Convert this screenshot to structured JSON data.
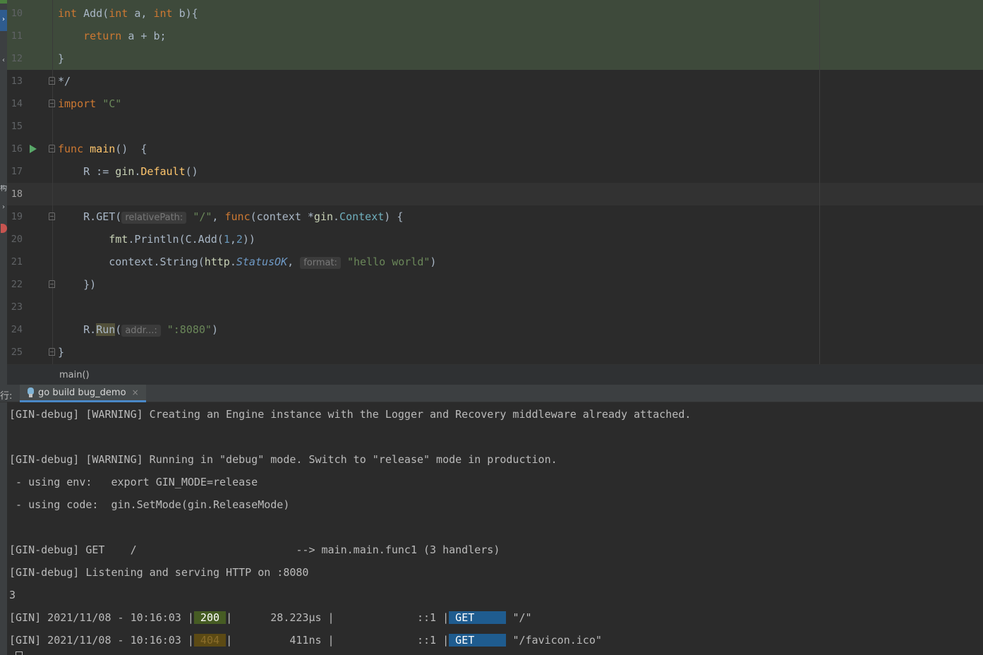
{
  "editor": {
    "lines": [
      {
        "num": "10",
        "segments": [
          {
            "c": "kw",
            "t": "int"
          },
          {
            "c": "",
            "t": " Add("
          },
          {
            "c": "kw",
            "t": "int"
          },
          {
            "c": "",
            "t": " a, "
          },
          {
            "c": "kw",
            "t": "int"
          },
          {
            "c": "",
            "t": " b){"
          }
        ]
      },
      {
        "num": "11",
        "segments": [
          {
            "c": "",
            "t": "    "
          },
          {
            "c": "kw",
            "t": "return"
          },
          {
            "c": "",
            "t": " a + b;"
          }
        ]
      },
      {
        "num": "12",
        "segments": [
          {
            "c": "",
            "t": "}"
          }
        ]
      },
      {
        "num": "13",
        "segments": [
          {
            "c": "",
            "t": "*/"
          }
        ]
      },
      {
        "num": "14",
        "segments": [
          {
            "c": "kw",
            "t": "import"
          },
          {
            "c": "",
            "t": " "
          },
          {
            "c": "str",
            "t": "\"C\""
          }
        ]
      },
      {
        "num": "15",
        "segments": []
      },
      {
        "num": "16",
        "segments": [
          {
            "c": "kw",
            "t": "func"
          },
          {
            "c": "",
            "t": " "
          },
          {
            "c": "fn",
            "t": "main"
          },
          {
            "c": "",
            "t": "()  {"
          }
        ]
      },
      {
        "num": "17",
        "segments": [
          {
            "c": "",
            "t": "    R := "
          },
          {
            "c": "pkg",
            "t": "gin"
          },
          {
            "c": "",
            "t": "."
          },
          {
            "c": "fn",
            "t": "Default"
          },
          {
            "c": "",
            "t": "()"
          }
        ]
      },
      {
        "num": "18",
        "segments": []
      },
      {
        "num": "19",
        "segments": [
          {
            "c": "",
            "t": "    R."
          },
          {
            "c": "",
            "t": "GET"
          },
          {
            "c": "",
            "t": "("
          },
          {
            "c": "hint",
            "t": "relativePath:"
          },
          {
            "c": "",
            "t": " "
          },
          {
            "c": "str",
            "t": "\"/\""
          },
          {
            "c": "",
            "t": ", "
          },
          {
            "c": "kw",
            "t": "func"
          },
          {
            "c": "",
            "t": "(context *"
          },
          {
            "c": "pkg",
            "t": "gin"
          },
          {
            "c": "",
            "t": "."
          },
          {
            "c": "typ",
            "t": "Context"
          },
          {
            "c": "",
            "t": ") {"
          }
        ]
      },
      {
        "num": "20",
        "segments": [
          {
            "c": "",
            "t": "        "
          },
          {
            "c": "pkg",
            "t": "fmt"
          },
          {
            "c": "",
            "t": "."
          },
          {
            "c": "",
            "t": "Println(C.Add("
          },
          {
            "c": "num",
            "t": "1"
          },
          {
            "c": "",
            "t": ","
          },
          {
            "c": "num",
            "t": "2"
          },
          {
            "c": "",
            "t": "))"
          }
        ]
      },
      {
        "num": "21",
        "segments": [
          {
            "c": "",
            "t": "        context."
          },
          {
            "c": "",
            "t": "String"
          },
          {
            "c": "",
            "t": "("
          },
          {
            "c": "pkg",
            "t": "http"
          },
          {
            "c": "",
            "t": "."
          },
          {
            "c": "ital",
            "t": "StatusOK"
          },
          {
            "c": "",
            "t": ", "
          },
          {
            "c": "hint",
            "t": "format:"
          },
          {
            "c": "",
            "t": " "
          },
          {
            "c": "str",
            "t": "\"hello world\""
          },
          {
            "c": "",
            "t": ")"
          }
        ]
      },
      {
        "num": "22",
        "segments": [
          {
            "c": "",
            "t": "    })"
          }
        ]
      },
      {
        "num": "23",
        "segments": []
      },
      {
        "num": "24",
        "segments": [
          {
            "c": "",
            "t": "    R."
          },
          {
            "c": "run-hl",
            "t": "Run"
          },
          {
            "c": "",
            "t": "("
          },
          {
            "c": "hint",
            "t": "addr...:"
          },
          {
            "c": "",
            "t": " "
          },
          {
            "c": "str",
            "t": "\":8080\""
          },
          {
            "c": "",
            "t": ")"
          }
        ]
      },
      {
        "num": "25",
        "segments": [
          {
            "c": "",
            "t": "}"
          }
        ]
      }
    ]
  },
  "breadcrumb": {
    "text": "main()"
  },
  "run_window": {
    "label": "行:",
    "tab_label": "go build bug_demo",
    "tab_close": "×"
  },
  "console": {
    "lines": [
      {
        "segments": [
          {
            "c": "",
            "t": "[GIN-debug] [WARNING] Creating an Engine instance with the Logger and Recovery middleware already attached."
          }
        ]
      },
      {
        "segments": []
      },
      {
        "segments": [
          {
            "c": "",
            "t": "[GIN-debug] [WARNING] Running in \"debug\" mode. Switch to \"release\" mode in production."
          }
        ]
      },
      {
        "segments": [
          {
            "c": "",
            "t": " - using env:   export GIN_MODE=release"
          }
        ]
      },
      {
        "segments": [
          {
            "c": "",
            "t": " - using code:  gin.SetMode(gin.ReleaseMode)"
          }
        ]
      },
      {
        "segments": []
      },
      {
        "segments": [
          {
            "c": "",
            "t": "[GIN-debug] GET    /                         --> main.main.func1 (3 handlers)"
          }
        ]
      },
      {
        "segments": [
          {
            "c": "",
            "t": "[GIN-debug] Listening and serving HTTP on :8080"
          }
        ]
      },
      {
        "segments": [
          {
            "c": "",
            "t": "3"
          }
        ]
      },
      {
        "segments": [
          {
            "c": "",
            "t": "[GIN] 2021/11/08 - 10:16:03 |"
          },
          {
            "c": "b200",
            "t": " 200 "
          },
          {
            "c": "",
            "t": "|      28.223µs |             ::1 |"
          },
          {
            "c": "bget",
            "t": " GET     "
          },
          {
            "c": "",
            "t": " \"/\""
          }
        ]
      },
      {
        "segments": [
          {
            "c": "",
            "t": "[GIN] 2021/11/08 - 10:16:03 |"
          },
          {
            "c": "b404",
            "t": " 404 "
          },
          {
            "c": "",
            "t": "|         411ns |             ::1 |"
          },
          {
            "c": "bget",
            "t": " GET     "
          },
          {
            "c": "",
            "t": " \"/favicon.ico\""
          }
        ]
      }
    ]
  },
  "left_strip": {
    "glyph_a": "›",
    "glyph_b": "‹",
    "glyph_c": "构",
    "glyph_d": "›"
  },
  "colors": {
    "keyword": "#cc7832",
    "string": "#6a8759",
    "function": "#ffc66d",
    "number": "#6897bb",
    "status_200": "#465c23",
    "status_404": "#5c4a14",
    "method_get": "#1f5c8f"
  }
}
